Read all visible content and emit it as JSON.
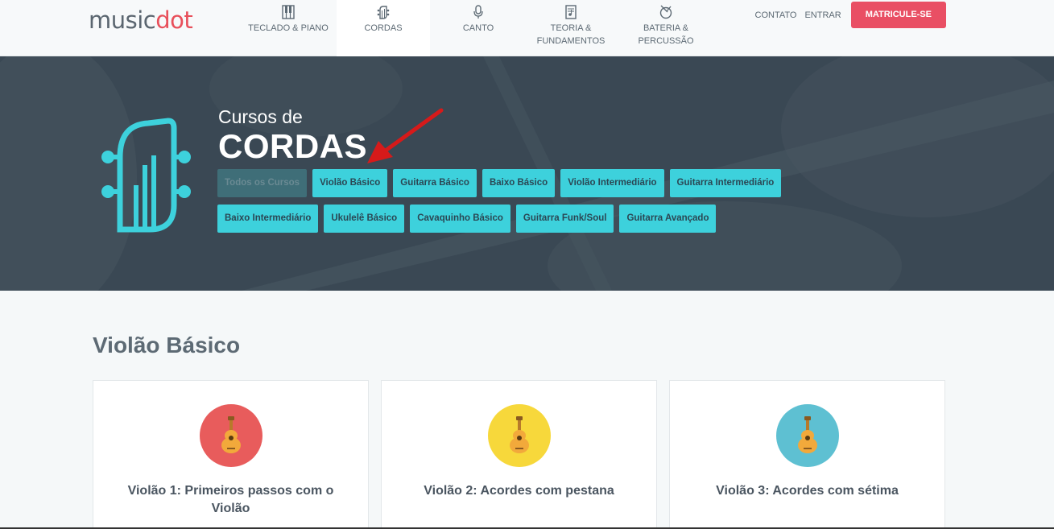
{
  "logo": {
    "part1": "music",
    "part2": "dot"
  },
  "nav": {
    "items": [
      {
        "label": "TECLADO & PIANO"
      },
      {
        "label": "CORDAS"
      },
      {
        "label": "CANTO"
      },
      {
        "label": "TEORIA &",
        "label2": "FUNDAMENTOS"
      },
      {
        "label": "BATERIA &",
        "label2": "PERCUSSÃO"
      }
    ],
    "contato": "CONTATO",
    "entrar": "ENTRAR",
    "cta": "MATRICULE-SE"
  },
  "hero": {
    "subtitle": "Cursos de",
    "title": "CORDAS",
    "tags_row1": [
      "Todos os Cursos",
      "Violão Básico",
      "Guitarra Básico",
      "Baixo Básico",
      "Violão Intermediário",
      "Guitarra Intermediário"
    ],
    "tags_row2": [
      "Baixo Intermediário",
      "Ukulelê Básico",
      "Cavaquinho Básico",
      "Guitarra Funk/Soul",
      "Guitarra Avançado"
    ]
  },
  "section": {
    "title": "Violão Básico",
    "cards": [
      {
        "title": "Violão 1: Primeiros passos com o Violão",
        "color": "#e85c5c",
        "icon": "guitar-icon"
      },
      {
        "title": "Violão 2: Acordes com pestana",
        "color": "#f7d83b",
        "icon": "guitar-icon"
      },
      {
        "title": "Violão 3: Acordes com sétima",
        "color": "#5ec0d2",
        "icon": "guitar-icon"
      }
    ]
  },
  "colors": {
    "accent": "#3dd1dc",
    "cta": "#e94f64",
    "hero_bg": "#3a4854"
  }
}
